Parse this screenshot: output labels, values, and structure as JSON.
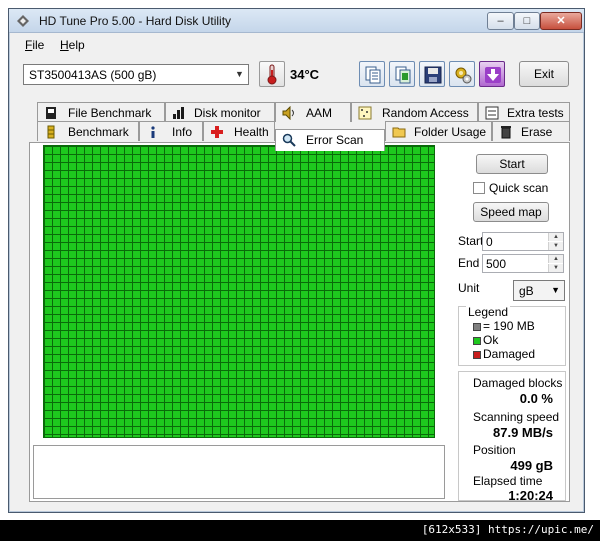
{
  "window": {
    "title": "HD Tune Pro 5.00 - Hard Disk Utility",
    "minimize_glyph": "–",
    "maximize_glyph": "□",
    "close_glyph": "✕"
  },
  "menu": {
    "file": {
      "mnemonic": "F",
      "rest": "ile"
    },
    "help": {
      "mnemonic": "H",
      "rest": "elp"
    }
  },
  "toolbar": {
    "drive": "ST3500413AS (500 gB)",
    "temperature": "34°C",
    "exit_label": "Exit",
    "icons": [
      "copy-text-icon",
      "copy-screenshot-icon",
      "save-icon",
      "options-icon",
      "download-icon"
    ]
  },
  "tabs": {
    "row1": [
      {
        "label": "File Benchmark",
        "icon": "file-benchmark-icon"
      },
      {
        "label": "Disk monitor",
        "icon": "disk-monitor-icon"
      },
      {
        "label": "AAM",
        "icon": "speaker-icon"
      },
      {
        "label": "Random Access",
        "icon": "random-access-icon"
      },
      {
        "label": "Extra tests",
        "icon": "extra-tests-icon"
      }
    ],
    "row2": [
      {
        "label": "Benchmark",
        "icon": "benchmark-icon"
      },
      {
        "label": "Info",
        "icon": "info-icon"
      },
      {
        "label": "Health",
        "icon": "health-cross-icon"
      },
      {
        "label": "Error Scan",
        "icon": "magnifier-icon"
      },
      {
        "label": "Folder Usage",
        "icon": "folder-icon"
      },
      {
        "label": "Erase",
        "icon": "trash-icon"
      }
    ],
    "active": "Error Scan"
  },
  "error_scan": {
    "start_button": "Start",
    "quick_scan_label": "Quick scan",
    "quick_scan_checked": false,
    "speed_map_button": "Speed map",
    "start_label": "Start",
    "start_value": "0",
    "end_label": "End",
    "end_value": "500",
    "unit_label": "Unit",
    "unit_value": "gB",
    "legend": {
      "title": "Legend",
      "block": "= 190 MB",
      "ok": "Ok",
      "damaged": "Damaged",
      "colors": {
        "block": "#808080",
        "ok": "#1ec81e",
        "damaged": "#c81e1e"
      }
    },
    "stats": {
      "damaged_blocks_label": "Damaged blocks",
      "damaged_blocks_value": "0.0 %",
      "scanning_speed_label": "Scanning speed",
      "scanning_speed_value": "87.9 MB/s",
      "position_label": "Position",
      "position_value": "499 gB",
      "elapsed_label": "Elapsed time",
      "elapsed_value": "1:20:24"
    },
    "grid_color": "#1ec81e",
    "all_blocks_ok": true
  },
  "watermark": "[612x533] https://upic.me/"
}
